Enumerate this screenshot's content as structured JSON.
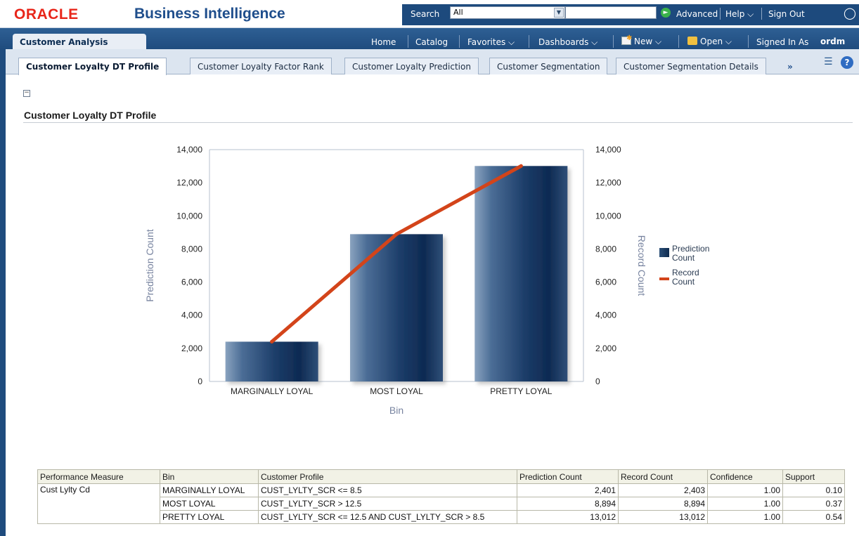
{
  "brand": {
    "logo": "ORACLE",
    "product": "Business Intelligence"
  },
  "search": {
    "label": "Search",
    "scope": "All",
    "query": ""
  },
  "top_links": {
    "advanced": "Advanced",
    "help": "Help ⌵",
    "sign_out": "Sign Out"
  },
  "dashboard": {
    "name": "Customer Analysis"
  },
  "nav": {
    "home": "Home",
    "catalog": "Catalog",
    "favorites": "Favorites ⌵",
    "dashboards": "Dashboards ⌵",
    "new": "New ⌵",
    "open": "Open ⌵",
    "signed_in_as": "Signed In As",
    "user": "ordm"
  },
  "tabs": [
    {
      "label": "Customer Loyalty DT Profile",
      "active": true
    },
    {
      "label": "Customer Loyalty Factor Rank",
      "active": false
    },
    {
      "label": "Customer Loyalty Prediction",
      "active": false
    },
    {
      "label": "Customer Segmentation",
      "active": false
    },
    {
      "label": "Customer Segmentation Details",
      "active": false
    }
  ],
  "more_tabs": "»",
  "section": {
    "collapse": "−",
    "title": "Customer Loyalty DT Profile"
  },
  "chart_data": {
    "type": "bar",
    "categories": [
      "MARGINALLY LOYAL",
      "MOST LOYAL",
      "PRETTY LOYAL"
    ],
    "series": [
      {
        "name": "Prediction Count",
        "type": "bar",
        "axis": "left",
        "values": [
          2401,
          8894,
          13012
        ]
      },
      {
        "name": "Record Count",
        "type": "line",
        "axis": "right",
        "values": [
          2403,
          8894,
          13012
        ]
      }
    ],
    "xlabel": "Bin",
    "ylabel": "Prediction Count",
    "y2label": "Record Count",
    "ylim": [
      0,
      14000
    ],
    "y2lim": [
      0,
      14000
    ],
    "yticks": [
      "0",
      "2,000",
      "4,000",
      "6,000",
      "8,000",
      "10,000",
      "12,000",
      "14,000"
    ],
    "legend": [
      "Prediction Count",
      "Record Count"
    ],
    "legend_placement": "right",
    "colors": {
      "bar": "#1d3d66",
      "line": "#d3441a"
    }
  },
  "legend_labels": {
    "prediction": "Prediction Count",
    "record": "Record Count"
  },
  "table": {
    "columns": [
      "Performance Measure",
      "Bin",
      "Customer Profile",
      "Prediction Count",
      "Record Count",
      "Confidence",
      "Support"
    ],
    "measure": "Cust Lylty Cd",
    "rows": [
      {
        "bin": "MARGINALLY LOYAL",
        "profile": "CUST_LYLTY_SCR <= 8.5",
        "prediction": "2,401",
        "record": "2,403",
        "confidence": "1.00",
        "support": "0.10"
      },
      {
        "bin": "MOST LOYAL",
        "profile": "CUST_LYLTY_SCR > 12.5",
        "prediction": "8,894",
        "record": "8,894",
        "confidence": "1.00",
        "support": "0.37"
      },
      {
        "bin": "PRETTY LOYAL",
        "profile": "CUST_LYLTY_SCR <= 12.5 AND CUST_LYLTY_SCR > 8.5",
        "prediction": "13,012",
        "record": "13,012",
        "confidence": "1.00",
        "support": "0.54"
      }
    ]
  }
}
